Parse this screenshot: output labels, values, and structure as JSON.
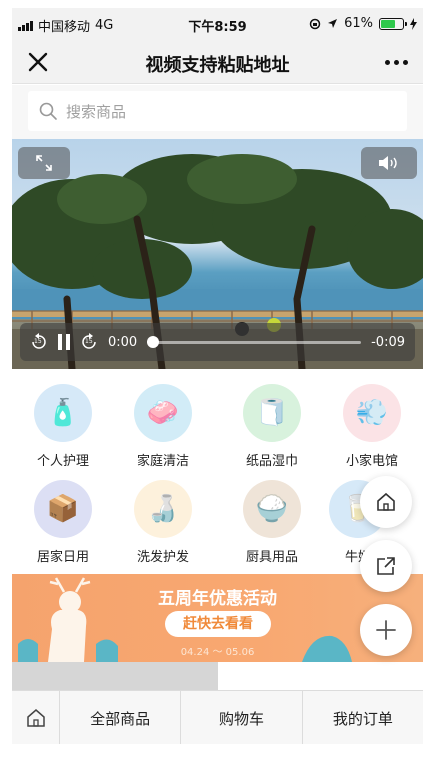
{
  "status_bar": {
    "carrier": "中国移动",
    "network": "4G",
    "time": "下午8:59",
    "battery": "61%",
    "battery_level": 0.61
  },
  "nav": {
    "title": "视频支持粘贴地址",
    "close_icon": "close-icon",
    "more_icon": "more-icon"
  },
  "search": {
    "placeholder": "搜索商品"
  },
  "video": {
    "current_time": "0:00",
    "remaining_time": "-0:09",
    "rewind_label": "15",
    "forward_label": "15",
    "progress": 0.0
  },
  "categories": [
    {
      "label": "个人护理",
      "icon": "personal-care-icon",
      "color": "#d6e9f8"
    },
    {
      "label": "家庭清洁",
      "icon": "cleaning-icon",
      "color": "#d2ecf7"
    },
    {
      "label": "纸品湿巾",
      "icon": "tissue-icon",
      "color": "#d8f2dd"
    },
    {
      "label": "小家电馆",
      "icon": "appliance-icon",
      "color": "#fbe3e6"
    },
    {
      "label": "居家日用",
      "icon": "home-goods-icon",
      "color": "#dcdff4"
    },
    {
      "label": "洗发护发",
      "icon": "shampoo-icon",
      "color": "#fdf1dc"
    },
    {
      "label": "厨具用品",
      "icon": "kitchen-icon",
      "color": "#efe4d8"
    },
    {
      "label": "牛奶",
      "icon": "milk-icon",
      "color": "#d6e9f8"
    }
  ],
  "banner": {
    "title": "五周年优惠活动",
    "button": "赶快去看看",
    "dates": "04.24 ～ 05.06"
  },
  "tabs": {
    "all_products": "全部商品",
    "cart": "购物车",
    "my_orders": "我的订单"
  },
  "colors": {
    "accent": "#f08a3a",
    "banner": "#f8a871"
  }
}
